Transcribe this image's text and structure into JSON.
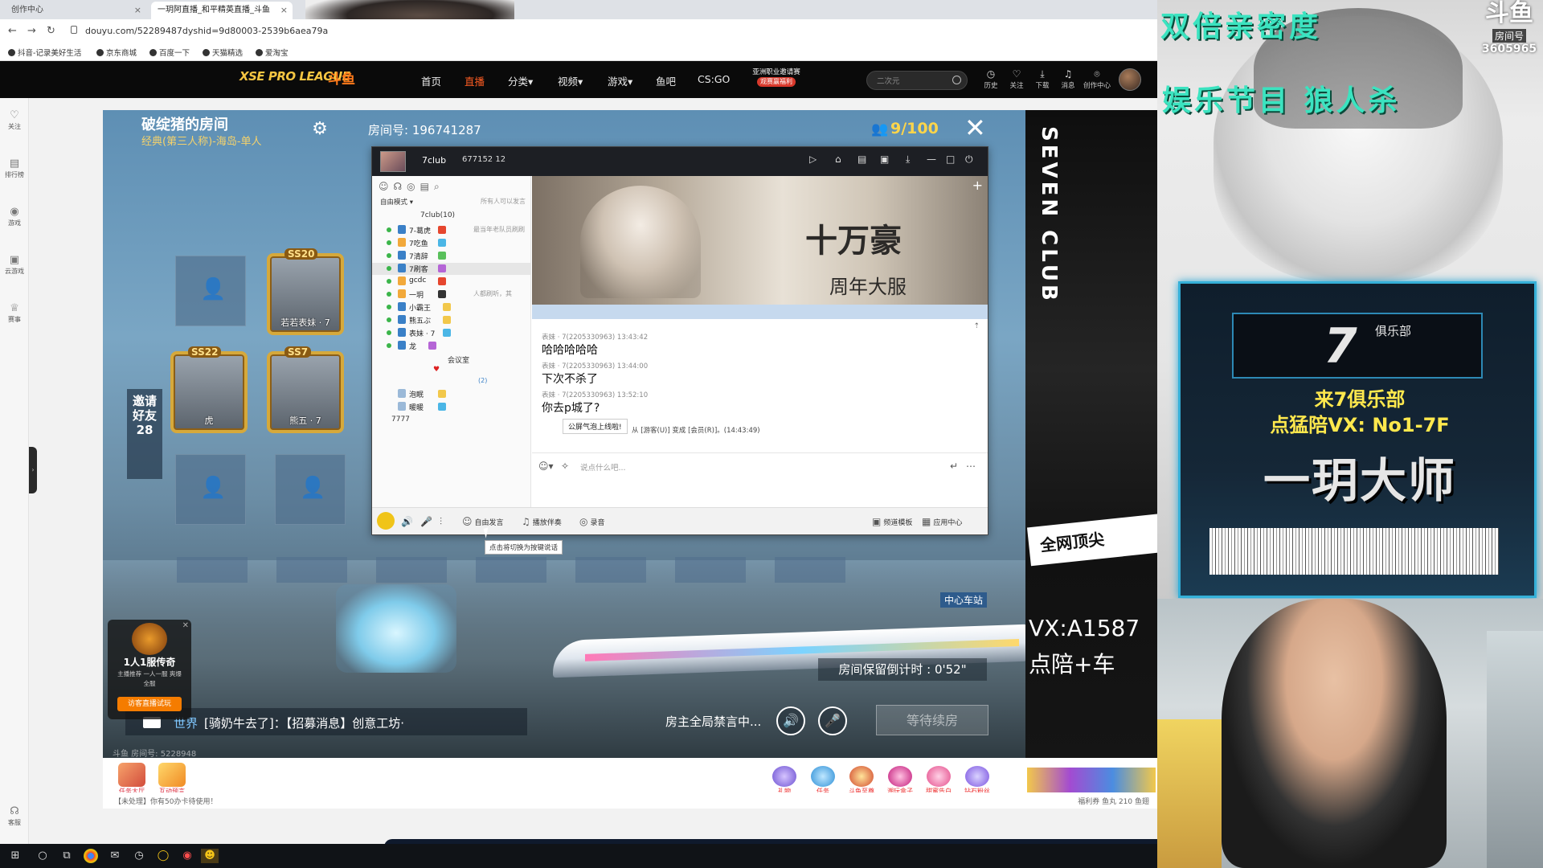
{
  "browser": {
    "tabs": [
      {
        "label": "创作中心"
      },
      {
        "label": "一玥阿直播_和平精英直播_斗鱼",
        "active": true
      }
    ],
    "url": "douyu.com/52289487dyshid=9d80003-2539b6aea79a",
    "bookmarks": [
      "抖音-记录美好生活",
      "京东商城",
      "百度一下",
      "天猫精选",
      "爱淘宝"
    ]
  },
  "header": {
    "logo_league": "XSE PRO LEAGUE",
    "logo_brand": "斗鱼",
    "nav": [
      "首页",
      "直播",
      "分类",
      "视频",
      "游戏",
      "鱼吧",
      "CS:GO"
    ],
    "active_nav": "直播",
    "promo_line": "亚洲职业邀请赛",
    "promo_tag": "观赛赢福利",
    "search_placeholder": "二次元",
    "icons": [
      "历史",
      "关注",
      "下载",
      "消息",
      "创作中心"
    ],
    "accent": "#ff5d23"
  },
  "sidebar": {
    "items": [
      "关注",
      "排行榜",
      "游戏",
      "云游戏",
      "赛事",
      "客服"
    ]
  },
  "game": {
    "room_title": "破绽猪的房间",
    "room_mode": "经典(第三人称)-海岛-单人",
    "room_number": "房间号: 196741287",
    "people": "9/100",
    "invite": "邀请好友28",
    "cards": [
      {
        "season": "SS20",
        "name": "若若表妹 · 7"
      },
      {
        "season": "SS22",
        "name": "虎"
      },
      {
        "season": "SS7",
        "name": "熊五 · 7"
      }
    ],
    "station": "中心车站",
    "countdown": "房间保留倒计时 : 0'52\"",
    "chat_channel": "世界",
    "chat_message": "[骑奶牛去了]：【招募消息】创意工坊·",
    "muted": "房主全局禁言中...",
    "wait_button": "等待续房",
    "room_id_faint": "斗鱼 房间号: 5228948"
  },
  "ad": {
    "title": "1人1服传奇",
    "sub": "主播推荐 一人一服 爽爆全服",
    "button": "访客直播试玩"
  },
  "poster": {
    "vertical": "SEVEN CLUB",
    "slogan": "全网顶尖",
    "vx": "VX:A1587",
    "line2": "点陪+车"
  },
  "yy": {
    "channel_name": "7club",
    "meta": "677152   12",
    "mode": "自由模式",
    "mode_hint": "所有人可以发言",
    "channel_header": "7club(10)",
    "users": [
      {
        "name": "7-葛虎",
        "extra": "最当年老队员刷刷"
      },
      {
        "name": "7吃鱼",
        "extra": ""
      },
      {
        "name": "7清辞",
        "extra": ""
      },
      {
        "name": "7刷客",
        "extra": "",
        "selected": true
      },
      {
        "name": "gcdc",
        "extra": ""
      },
      {
        "name": "一玥",
        "extra": "人都刷听，其"
      },
      {
        "name": "小霸王",
        "extra": ""
      },
      {
        "name": "熊五ぶ",
        "extra": ""
      },
      {
        "name": "表妹 · 7",
        "extra": ""
      },
      {
        "name": "龙",
        "extra": ""
      }
    ],
    "room_label": "会议室",
    "room_count": "(2)",
    "sub_users": [
      "泡眠",
      "暖暖"
    ],
    "sub_channel": "7777",
    "banner_big": "十万豪",
    "banner_sub": "周年大服",
    "messages": [
      {
        "meta": "表妹 · 7(2205330963)  13:43:42",
        "text": "哈哈哈哈哈"
      },
      {
        "meta": "表妹 · 7(2205330963)  13:44:00",
        "text": "下次不杀了"
      },
      {
        "meta": "表妹 · 7(2205330963)  13:52:10",
        "text": "你去p城了?"
      }
    ],
    "system_msg": "从 [游客(U)] 变成 [会员(R)]。(14:43:49)",
    "tip": "公屏气泡上线啦!",
    "input_placeholder": "说点什么吧...",
    "bottom_buttons": [
      "自由发言",
      "播放伴奏",
      "录音"
    ],
    "bottom_right": [
      "频道模板",
      "应用中心"
    ],
    "tooltip": "点击将切换为按键说话"
  },
  "bottom_row": {
    "tasks": [
      "任务大厅",
      "互动预言"
    ],
    "gifts": [
      "礼物",
      "任务",
      "斗鱼至尊",
      "潮玩盒子",
      "甜蜜告白",
      "钻石粉丝"
    ],
    "status_left": "【未处理】你有50办卡待使用！",
    "status_right": "福利券  鱼丸 210  鱼翅"
  },
  "overlay": {
    "title1": "双倍亲密度",
    "title2": "娱乐节目 狼人杀",
    "badge_label": "房间号",
    "badge_number": "3605965",
    "club_small": "俱乐部",
    "club_line1": "来7俱乐部",
    "club_line2": "点猛陪VX: No1-7F",
    "club_name": "一玥大师",
    "accent": "#3be3c0"
  }
}
